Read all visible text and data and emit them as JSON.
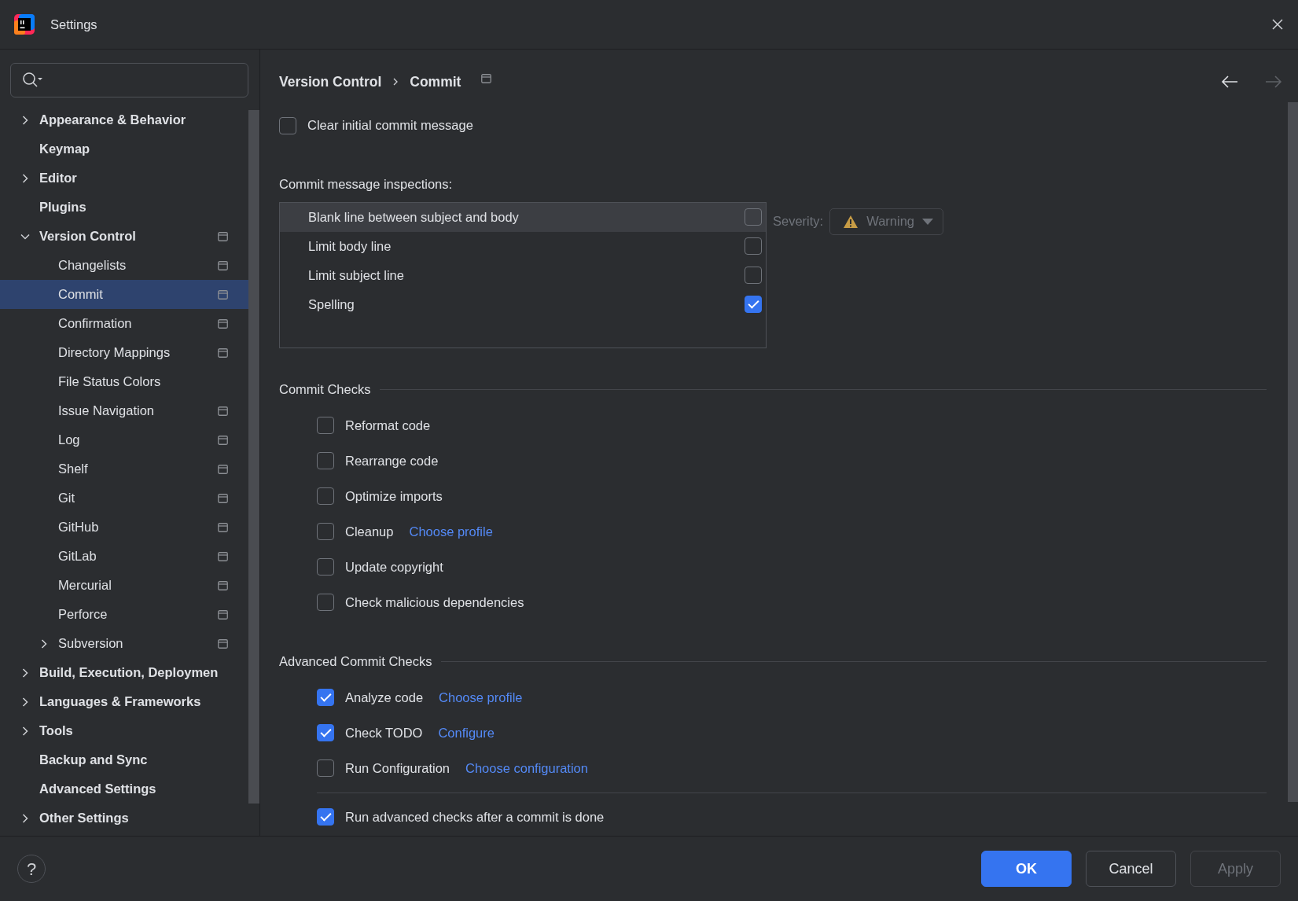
{
  "window": {
    "title": "Settings"
  },
  "sidebar": {
    "items": [
      {
        "label": "Appearance & Behavior",
        "expandable": true,
        "expanded": false,
        "selected": false,
        "project_level": false
      },
      {
        "label": "Keymap",
        "expandable": false,
        "expanded": false,
        "selected": false,
        "project_level": false
      },
      {
        "label": "Editor",
        "expandable": true,
        "expanded": false,
        "selected": false,
        "project_level": false
      },
      {
        "label": "Plugins",
        "expandable": false,
        "expanded": false,
        "selected": false,
        "project_level": false
      },
      {
        "label": "Version Control",
        "expandable": true,
        "expanded": true,
        "selected": false,
        "project_level": true,
        "children": [
          {
            "label": "Changelists",
            "expandable": false,
            "expanded": false,
            "selected": false,
            "project_level": true
          },
          {
            "label": "Commit",
            "expandable": false,
            "expanded": false,
            "selected": true,
            "project_level": true
          },
          {
            "label": "Confirmation",
            "expandable": false,
            "expanded": false,
            "selected": false,
            "project_level": true
          },
          {
            "label": "Directory Mappings",
            "expandable": false,
            "expanded": false,
            "selected": false,
            "project_level": true
          },
          {
            "label": "File Status Colors",
            "expandable": false,
            "expanded": false,
            "selected": false,
            "project_level": false
          },
          {
            "label": "Issue Navigation",
            "expandable": false,
            "expanded": false,
            "selected": false,
            "project_level": true
          },
          {
            "label": "Log",
            "expandable": false,
            "expanded": false,
            "selected": false,
            "project_level": true
          },
          {
            "label": "Shelf",
            "expandable": false,
            "expanded": false,
            "selected": false,
            "project_level": true
          },
          {
            "label": "Git",
            "expandable": false,
            "expanded": false,
            "selected": false,
            "project_level": true
          },
          {
            "label": "GitHub",
            "expandable": false,
            "expanded": false,
            "selected": false,
            "project_level": true
          },
          {
            "label": "GitLab",
            "expandable": false,
            "expanded": false,
            "selected": false,
            "project_level": true
          },
          {
            "label": "Mercurial",
            "expandable": false,
            "expanded": false,
            "selected": false,
            "project_level": true
          },
          {
            "label": "Perforce",
            "expandable": false,
            "expanded": false,
            "selected": false,
            "project_level": true
          },
          {
            "label": "Subversion",
            "expandable": true,
            "expanded": false,
            "selected": false,
            "project_level": true
          }
        ]
      },
      {
        "label": "Build, Execution, Deploymen",
        "expandable": true,
        "expanded": false,
        "selected": false,
        "project_level": false
      },
      {
        "label": "Languages & Frameworks",
        "expandable": true,
        "expanded": false,
        "selected": false,
        "project_level": false
      },
      {
        "label": "Tools",
        "expandable": true,
        "expanded": false,
        "selected": false,
        "project_level": false
      },
      {
        "label": "Backup and Sync",
        "expandable": false,
        "expanded": false,
        "selected": false,
        "project_level": false
      },
      {
        "label": "Advanced Settings",
        "expandable": false,
        "expanded": false,
        "selected": false,
        "project_level": false
      },
      {
        "label": "Other Settings",
        "expandable": true,
        "expanded": false,
        "selected": false,
        "project_level": false
      }
    ]
  },
  "breadcrumb": [
    "Version Control",
    "Commit"
  ],
  "nav": {
    "back_enabled": true,
    "forward_enabled": false
  },
  "clear_initial_message": {
    "label": "Clear initial commit message",
    "checked": false
  },
  "inspections": {
    "label": "Commit message inspections:",
    "items": [
      {
        "label": "Blank line between subject and body",
        "checked": false,
        "selected": true
      },
      {
        "label": "Limit body line",
        "checked": false,
        "selected": false
      },
      {
        "label": "Limit subject line",
        "checked": false,
        "selected": false
      },
      {
        "label": "Spelling",
        "checked": true,
        "selected": false
      }
    ],
    "severity": {
      "label": "Severity:",
      "value": "Warning",
      "disabled": true
    }
  },
  "sections": [
    {
      "title": "Commit Checks",
      "items": [
        {
          "label": "Reformat code",
          "checked": false,
          "after_divider": false
        },
        {
          "label": "Rearrange code",
          "checked": false,
          "after_divider": false
        },
        {
          "label": "Optimize imports",
          "checked": false,
          "after_divider": false
        },
        {
          "label": "Cleanup",
          "checked": false,
          "after_divider": false,
          "link": "Choose profile"
        },
        {
          "label": "Update copyright",
          "checked": false,
          "after_divider": false
        },
        {
          "label": "Check malicious dependencies",
          "checked": false,
          "after_divider": false
        }
      ]
    },
    {
      "title": "Advanced Commit Checks",
      "items": [
        {
          "label": "Analyze code",
          "checked": true,
          "after_divider": false,
          "link": "Choose profile"
        },
        {
          "label": "Check TODO",
          "checked": true,
          "after_divider": false,
          "link": "Configure"
        },
        {
          "label": "Run Configuration",
          "checked": false,
          "after_divider": false,
          "link": "Choose configuration"
        },
        {
          "label": "Run advanced checks after a commit is done",
          "checked": true,
          "after_divider": true
        }
      ]
    }
  ],
  "help_button": {
    "label": "?"
  },
  "buttons": [
    {
      "label": "OK",
      "kind": "primary",
      "disabled": false
    },
    {
      "label": "Cancel",
      "kind": "secondary",
      "disabled": false
    },
    {
      "label": "Apply",
      "kind": "secondary",
      "disabled": true
    }
  ]
}
